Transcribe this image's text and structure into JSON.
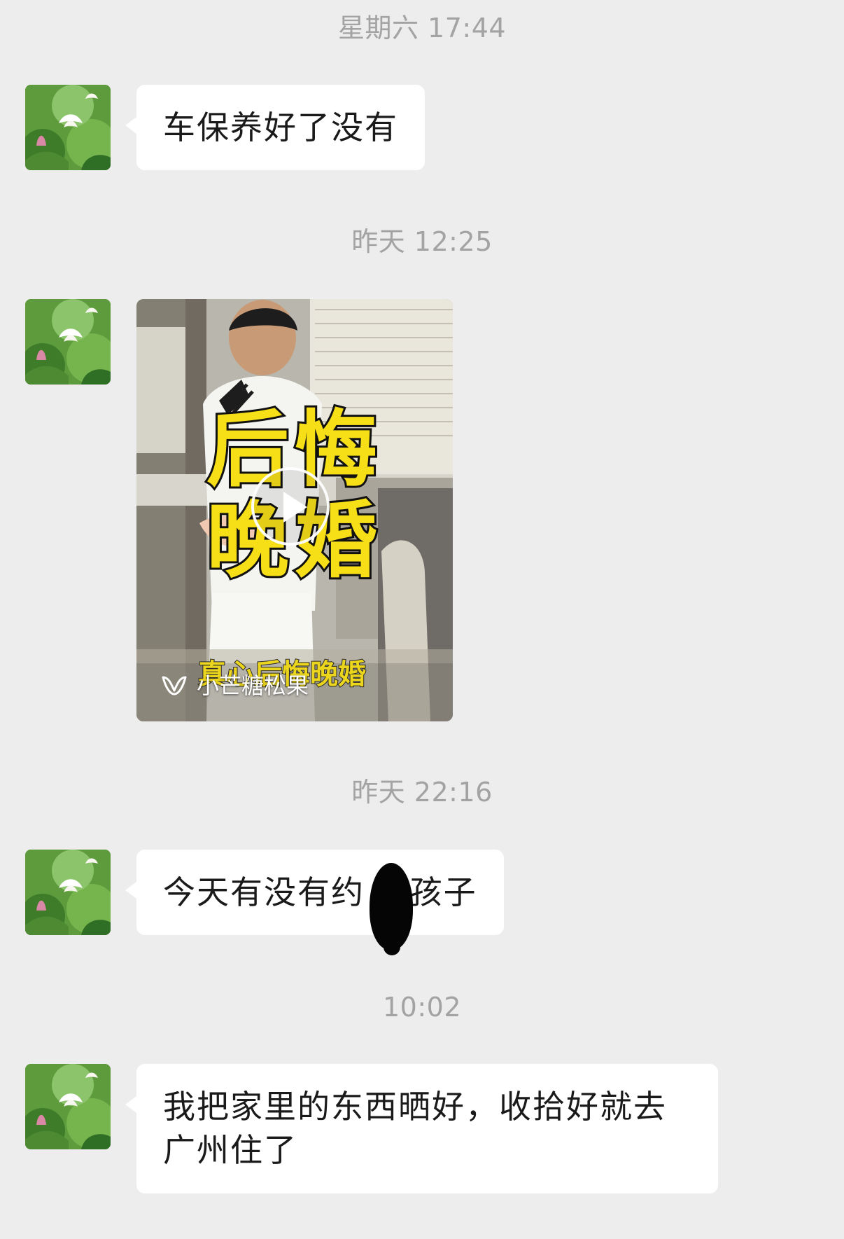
{
  "chat": {
    "entries": [
      {
        "timestamp": "星期六 17:44",
        "message": "车保养好了没有"
      },
      {
        "timestamp": "昨天 12:25",
        "video": {
          "title_line_1": "后悔",
          "title_line_2": "晚婚",
          "caption": "真心后悔晚婚",
          "source": "小芒糖松果",
          "source_icon": "mango-logo-icon",
          "accent_color": "#f7df18"
        }
      },
      {
        "timestamp": "昨天 22:16",
        "message": "今天有没有约  女孩子"
      },
      {
        "timestamp": "10:02",
        "message_line_1": "我把家里的东西晒好，收拾好就去",
        "message_line_2": "广州住了"
      }
    ]
  },
  "theme": {
    "background": "#ededed",
    "bubble": "#ffffff",
    "timestamp_color": "#a3a3a3"
  },
  "avatar": {
    "icon": "lotus-avatar-icon"
  }
}
